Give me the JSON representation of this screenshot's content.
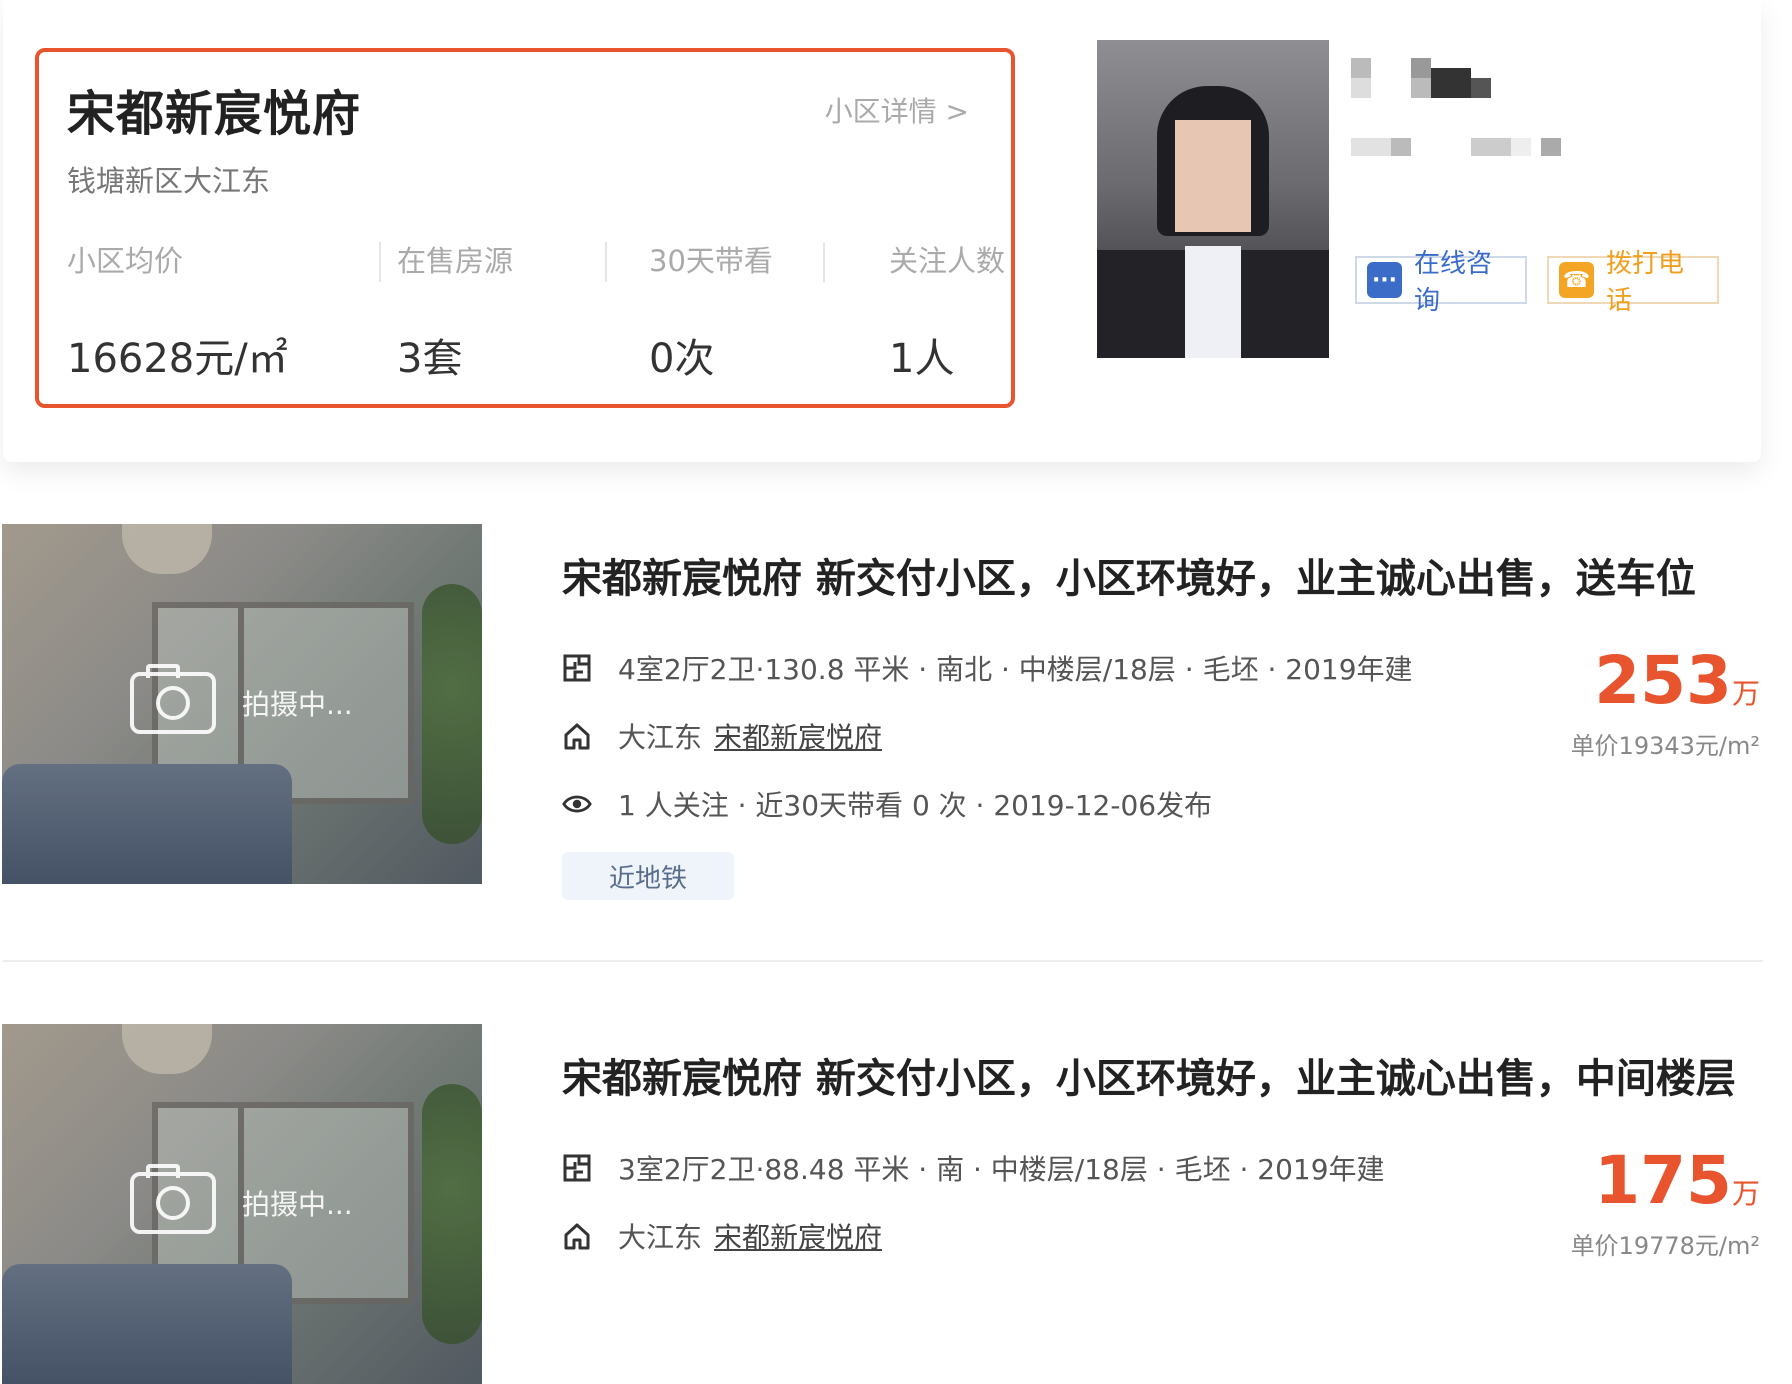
{
  "community": {
    "name": "宋都新宸悦府",
    "detail_link": "小区详情 >",
    "area": "钱塘新区大江东",
    "stats": [
      {
        "label": "小区均价",
        "value": "16628元/㎡"
      },
      {
        "label": "在售房源",
        "value": "3套"
      },
      {
        "label": "30天带看",
        "value": "0次"
      },
      {
        "label": "关注人数",
        "value": "1人"
      }
    ]
  },
  "agent": {
    "online_label": "在线咨询",
    "call_label": "拨打电话"
  },
  "listings": [
    {
      "title": "宋都新宸悦府 新交付小区，小区环境好，业主诚心出售，送车位",
      "photo_status": "拍摄中...",
      "specs": "4室2厅2卫·130.8 平米 · 南北 · 中楼层/18层 · 毛坯 · 2019年建",
      "location_area": "大江东",
      "location_community": "宋都新宸悦府",
      "follow": "1 人关注 · 近30天带看 0 次 · 2019-12-06发布",
      "tag": "近地铁",
      "price": "253",
      "price_unit": "万",
      "unit_price": "单价19343元/m²"
    },
    {
      "title": "宋都新宸悦府 新交付小区，小区环境好，业主诚心出售，中间楼层",
      "photo_status": "拍摄中...",
      "specs": "3室2厅2卫·88.48 平米 · 南 · 中楼层/18层 · 毛坯 · 2019年建",
      "location_area": "大江东",
      "location_community": "宋都新宸悦府",
      "price": "175",
      "price_unit": "万",
      "unit_price": "单价19778元/m²"
    }
  ]
}
